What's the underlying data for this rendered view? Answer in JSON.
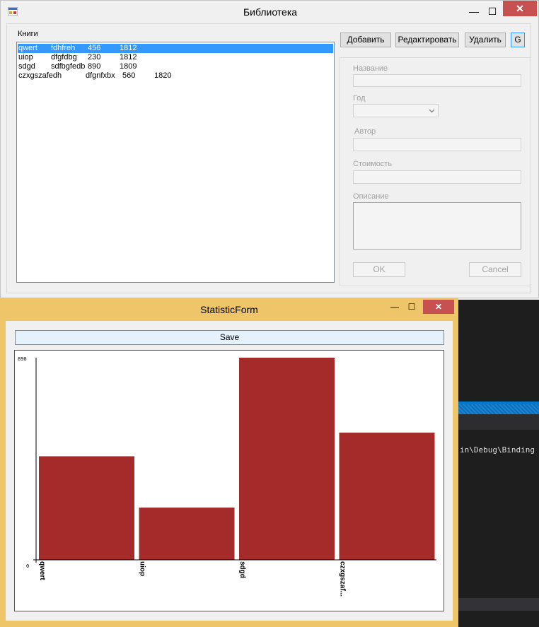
{
  "library": {
    "title": "Библиотека",
    "window_controls": {
      "minimize": "—",
      "maximize": "☐",
      "close": "✕"
    },
    "books_label": "Книги",
    "books": [
      {
        "title": "qwert",
        "author": "fdhfreh",
        "price": "456",
        "year": "1812",
        "selected": true
      },
      {
        "title": "uiop",
        "author": "dfgfdbg",
        "price": "230",
        "year": "1812",
        "selected": false
      },
      {
        "title": "sdgd",
        "author": "sdfbgfedb",
        "price": "890",
        "year": "1809",
        "selected": false
      },
      {
        "title": "czxgszafedh",
        "author": "dfgnfxbx",
        "price": "560",
        "year": "1820",
        "selected": false
      }
    ],
    "buttons": {
      "add": "Добавить",
      "edit": "Редактировать",
      "delete": "Удалить",
      "g": "G"
    },
    "form": {
      "name_label": "Название",
      "year_label": "Год",
      "author_label": "Автор",
      "cost_label": "Стоимость",
      "description_label": "Описание",
      "ok": "OK",
      "cancel": "Cancel"
    }
  },
  "statistic": {
    "title": "StatisticForm",
    "window_controls": {
      "minimize": "—",
      "maximize": "☐",
      "close": "✕"
    },
    "save_label": "Save"
  },
  "editor_snippet": "in\\Debug\\Binding",
  "chart_data": {
    "type": "bar",
    "categories": [
      "qwert",
      "uiop",
      "sdgd",
      "czxgszaf..."
    ],
    "values": [
      456,
      230,
      890,
      560
    ],
    "ylim": [
      0,
      890
    ],
    "y_tick_labels": [
      "0",
      "890"
    ],
    "grid": false,
    "bar_color": "#a52a2a"
  },
  "colors": {
    "selection": "#3399ff",
    "stat_frame": "#efc56a",
    "close_button": "#c75050"
  }
}
